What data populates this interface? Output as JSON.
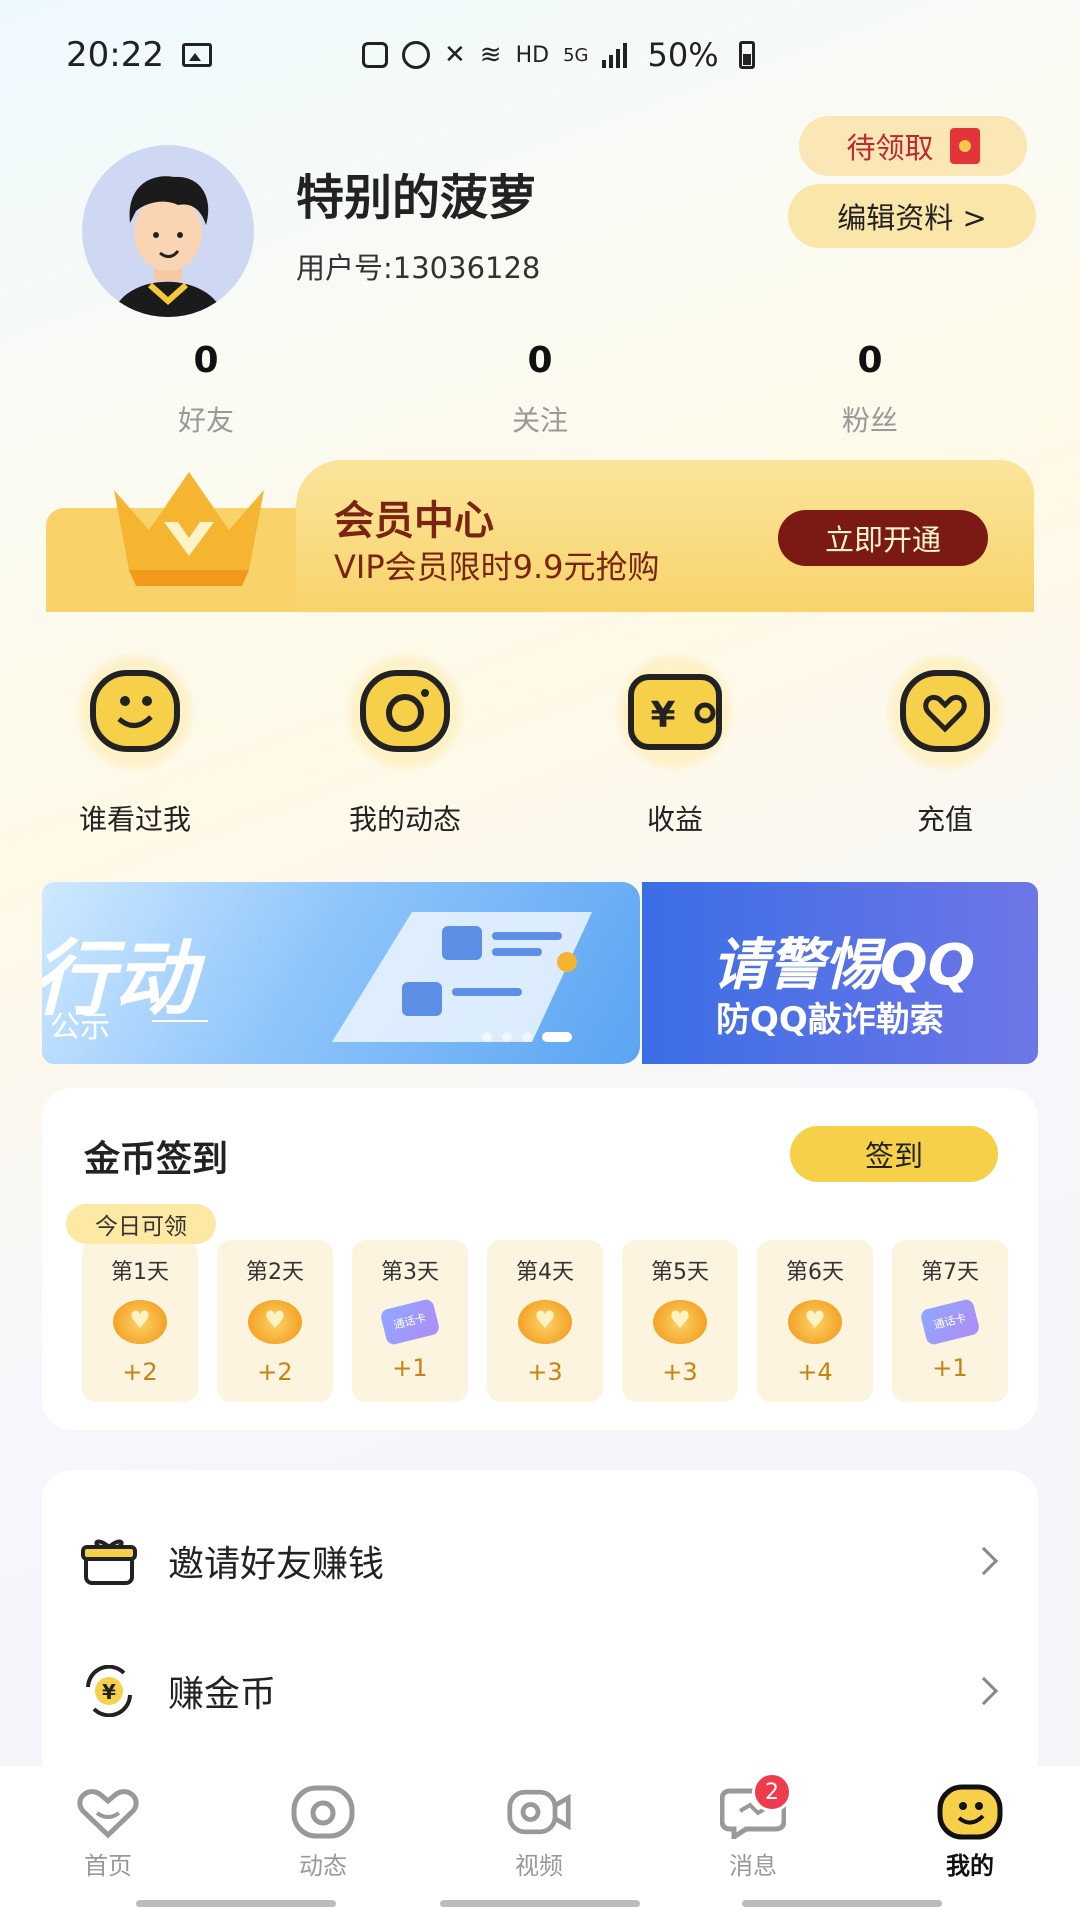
{
  "status_bar": {
    "time": "20:22",
    "network": "HD",
    "signal_label": "5G",
    "battery": "50%"
  },
  "profile": {
    "name": "特别的菠萝",
    "user_id": "用户号:13036128",
    "claim_label": "待领取",
    "edit_label": "编辑资料 >"
  },
  "stats": [
    {
      "value": "0",
      "label": "好友"
    },
    {
      "value": "0",
      "label": "关注"
    },
    {
      "value": "0",
      "label": "粉丝"
    }
  ],
  "vip": {
    "title": "会员中心",
    "subtitle": "VIP会员限时9.9元抢购",
    "button": "立即开通"
  },
  "shortcuts": [
    {
      "label": "谁看过我",
      "icon": "smile-face-icon"
    },
    {
      "label": "我的动态",
      "icon": "camera-icon"
    },
    {
      "label": "收益",
      "icon": "wallet-yen-icon"
    },
    {
      "label": "充值",
      "icon": "heart-icon"
    }
  ],
  "banner": {
    "left_big": "行动",
    "left_small": "公示",
    "right_big": "请警惕QQ",
    "right_small": "防QQ敲诈勒索"
  },
  "checkin": {
    "title": "金币签到",
    "button": "签到",
    "today_tag": "今日可领",
    "days": [
      {
        "label": "第1天",
        "reward": "+2",
        "type": "coin"
      },
      {
        "label": "第2天",
        "reward": "+2",
        "type": "coin"
      },
      {
        "label": "第3天",
        "reward": "+1",
        "type": "card"
      },
      {
        "label": "第4天",
        "reward": "+3",
        "type": "coin"
      },
      {
        "label": "第5天",
        "reward": "+3",
        "type": "coin"
      },
      {
        "label": "第6天",
        "reward": "+4",
        "type": "coin"
      },
      {
        "label": "第7天",
        "reward": "+1",
        "type": "card"
      }
    ],
    "card_text": "通话卡"
  },
  "menu": [
    {
      "label": "邀请好友赚钱",
      "icon": "gift-icon"
    },
    {
      "label": "赚金币",
      "icon": "yen-refresh-icon"
    }
  ],
  "bottom_nav": [
    {
      "label": "首页",
      "icon": "heart-smile-icon"
    },
    {
      "label": "动态",
      "icon": "camera-icon"
    },
    {
      "label": "视频",
      "icon": "video-icon"
    },
    {
      "label": "消息",
      "icon": "chat-icon",
      "badge": "2"
    },
    {
      "label": "我的",
      "icon": "smile-face-icon",
      "active": true
    }
  ],
  "colors": {
    "accent_yellow": "#f7d04a",
    "vip_brown": "#7b1a15",
    "badge_red": "#ef3b4e"
  }
}
